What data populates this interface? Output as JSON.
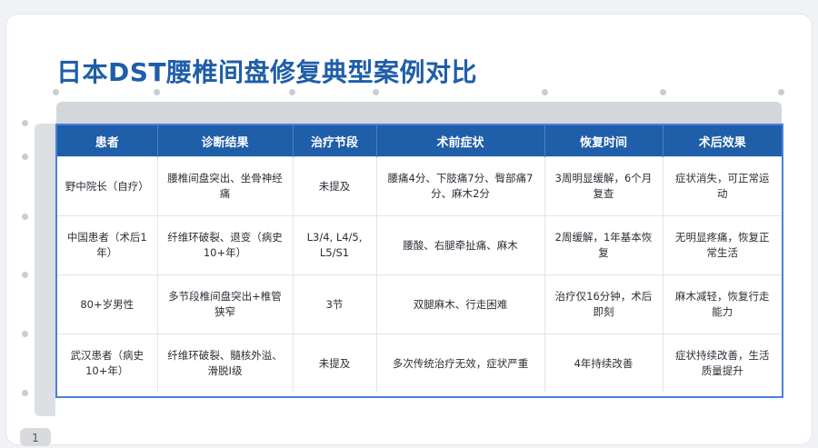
{
  "title": "日本DST腰椎间盘修复典型案例对比",
  "table": {
    "headers": [
      "患者",
      "诊断结果",
      "治疗节段",
      "术前症状",
      "恢复时间",
      "术后效果"
    ],
    "rows": [
      [
        "野中院长（自疗）",
        "腰椎间盘突出、坐骨神经痛",
        "未提及",
        "腰痛4分、下肢痛7分、臀部痛7分、麻木2分",
        "3周明显缓解，6个月复查",
        "症状消失，可正常运动"
      ],
      [
        "中国患者（术后1年）",
        "纤维环破裂、退变（病史10+年）",
        "L3/4, L4/5, L5/S1",
        "腰酸、右腿牵扯痛、麻木",
        "2周缓解，1年基本恢复",
        "无明显疼痛，恢复正常生活"
      ],
      [
        "80+岁男性",
        "多节段椎间盘突出+椎管狭窄",
        "3节",
        "双腿麻木、行走困难",
        "治疗仅16分钟，术后即刻",
        "麻木减轻，恢复行走能力"
      ],
      [
        "武汉患者（病史10+年）",
        "纤维环破裂、髓核外溢、滑脱Ⅰ级",
        "未提及",
        "多次传统治疗无效，症状严重",
        "4年持续改善",
        "症状持续改善，生活质量提升"
      ]
    ]
  },
  "page_number": "1",
  "colors": {
    "title": "#1f5ea8",
    "header_bg": "#1f5ea8",
    "frame": "#4a7fe0"
  }
}
